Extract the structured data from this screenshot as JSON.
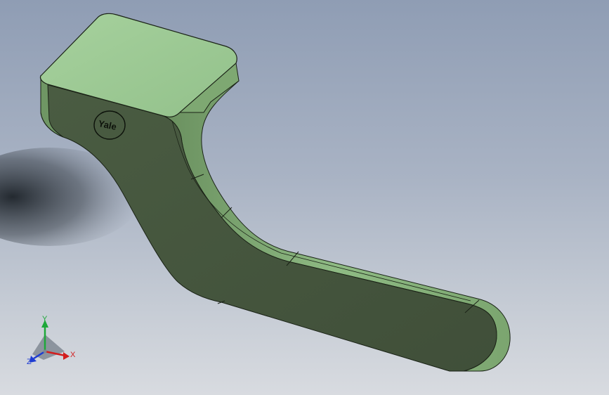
{
  "model": {
    "name": "door-handle",
    "logo_text": "Yale",
    "colors": {
      "top_face": "#9cc894",
      "side_face": "#44553d",
      "edge_band": "#7aa46e",
      "outline": "#1a2216",
      "background_top": "#8f9db4",
      "background_bottom": "#d8dbe0"
    }
  },
  "triad": {
    "x_label": "X",
    "y_label": "Y",
    "z_label": "Z",
    "x_color": "#d21e1e",
    "y_color": "#1ea83a",
    "z_color": "#1e3cd2"
  }
}
